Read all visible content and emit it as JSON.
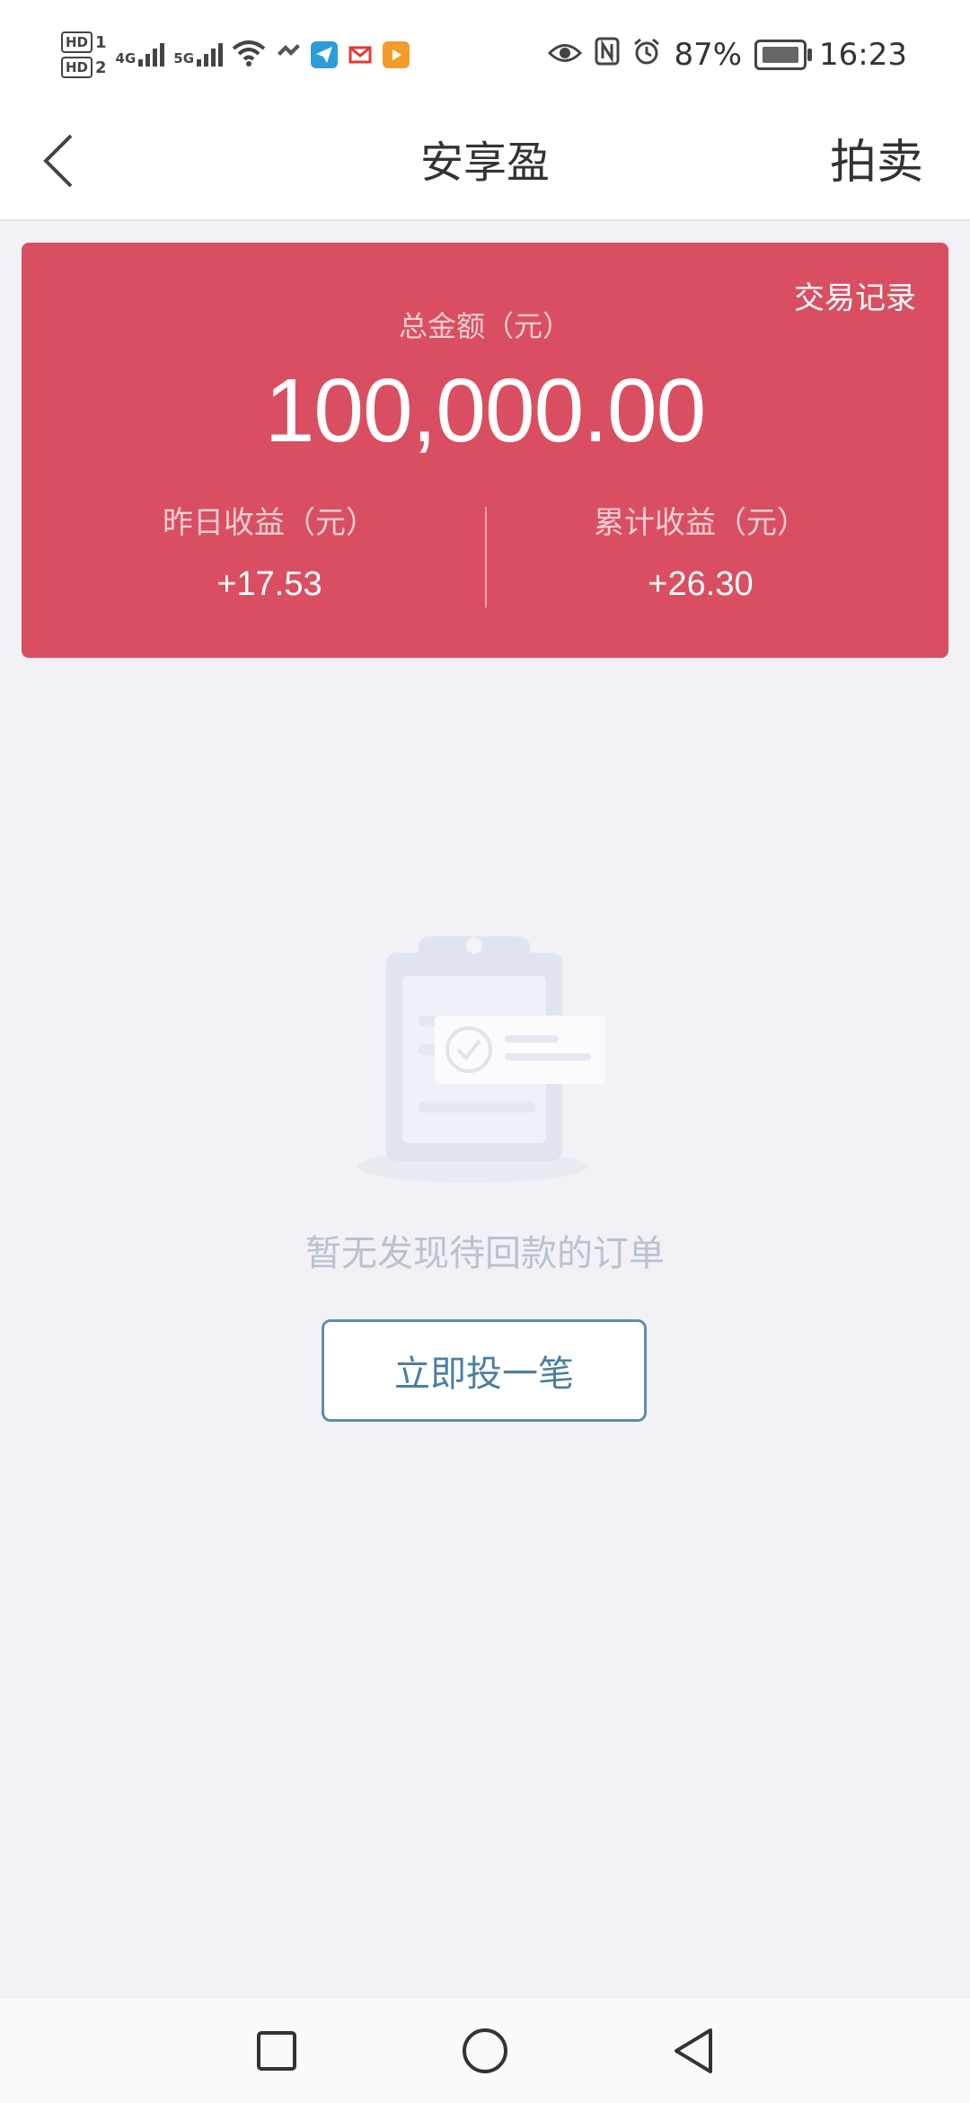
{
  "status_bar": {
    "sim1": "HD",
    "sim1_slot": "1",
    "sim2": "HD",
    "sim2_slot": "2",
    "net1": "4G",
    "net2": "5G",
    "battery_percent": "87%",
    "time": "16:23",
    "icons": [
      "wifi-icon",
      "heart-app-icon",
      "paper-plane-icon",
      "mail-app-icon",
      "video-app-icon",
      "eye-icon",
      "nfc-icon",
      "alarm-icon",
      "battery-icon"
    ]
  },
  "header": {
    "title": "安享盈",
    "action": "拍卖",
    "back_icon": "chevron-left-icon"
  },
  "summary": {
    "records_link": "交易记录",
    "total_label": "总金额（元）",
    "total_amount": "100,000.00",
    "yesterday_label": "昨日收益（元）",
    "yesterday_value": "+17.53",
    "cumulative_label": "累计收益（元）",
    "cumulative_value": "+26.30",
    "card_color": "#d94f61"
  },
  "empty_state": {
    "icon": "clipboard-check-icon",
    "message": "暂无发现待回款的订单",
    "button": "立即投一笔"
  },
  "nav_bar": {
    "items": [
      "recent-apps-icon",
      "home-icon",
      "back-icon"
    ]
  }
}
